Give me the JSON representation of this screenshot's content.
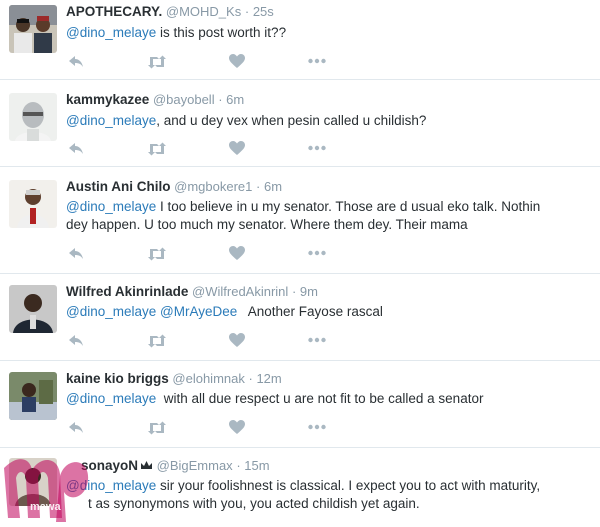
{
  "colors": {
    "mention": "#2b7bb9",
    "meta": "#8899a6",
    "action_icon": "#aab8c2",
    "divider": "#e1e8ed",
    "watermark": "#c0005a"
  },
  "icons": [
    "reply-icon",
    "retweet-icon",
    "like-icon",
    "more-icon",
    "crown-icon"
  ],
  "tweets": [
    {
      "name": "APOTHECARY.",
      "handle": "@MOHD_Ks",
      "sep": "·",
      "time": "25s",
      "mention": "@dino_melaye",
      "text": " is this post worth it??",
      "text2": ""
    },
    {
      "name": "kammykazee",
      "handle": "@bayobell",
      "sep": "·",
      "time": "6m",
      "mention": "@dino_melaye",
      "text": ", and u dey vex when pesin called u childish?",
      "text2": ""
    },
    {
      "name": "Austin Ani Chilo",
      "handle": "@mgbokere1",
      "sep": "·",
      "time": "6m",
      "mention": "@dino_melaye",
      "text": " I too believe in u my senator. Those are d usual eko talk. Nothin",
      "text2": "dey happen. U too much my senator. Where them dey. Their mama"
    },
    {
      "name": "Wilfred Akinrinlade",
      "handle": "@WilfredAkinrinl",
      "sep": "·",
      "time": "9m",
      "mention": "@dino_melaye",
      "mention2": "@MrAyeDee",
      "text": "   Another Fayose rascal",
      "text2": ""
    },
    {
      "name": "kaine kio briggs",
      "handle": "@elohimnak",
      "sep": "·",
      "time": "12m",
      "mention": "@dino_melaye",
      "text": "  with all due respect u are not fit to be called a senator",
      "text2": ""
    },
    {
      "name": "sonayoN",
      "handle": "@BigEmmax",
      "sep": "·",
      "time": "15m",
      "mention": "@dino_melaye",
      "text": " sir your foolishnest is classical. I expect you to act with maturity,",
      "text2": "t as synonymons with you, you acted childish yet again."
    }
  ],
  "watermark": {
    "letters": "mp",
    "subtext": "mawa"
  }
}
